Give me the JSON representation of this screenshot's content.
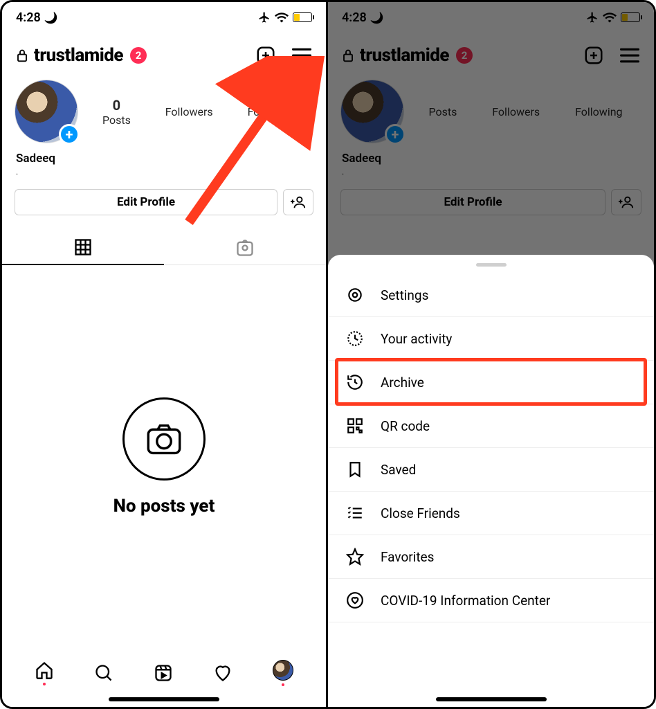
{
  "status": {
    "time": "4:28"
  },
  "colors": {
    "notif": "#ff2d55",
    "battery_fill": "#ffcc00",
    "highlight": "#ff3b1f",
    "plus_blue": "#0098fe"
  },
  "profile": {
    "username": "trustlamide",
    "notif_count": "2",
    "display_name": "Sadeeq",
    "bio": ".",
    "stats": {
      "posts_num": "0",
      "posts_label": "Posts",
      "followers_num": "",
      "followers_label": "Followers",
      "following_num": "",
      "following_label": "Following"
    },
    "edit_label": "Edit Profile"
  },
  "empty": {
    "message": "No posts yet"
  },
  "menu": {
    "items": [
      {
        "label": "Settings",
        "icon": "gear-icon"
      },
      {
        "label": "Your activity",
        "icon": "activity-icon"
      },
      {
        "label": "Archive",
        "icon": "archive-icon"
      },
      {
        "label": "QR code",
        "icon": "qrcode-icon"
      },
      {
        "label": "Saved",
        "icon": "bookmark-icon"
      },
      {
        "label": "Close Friends",
        "icon": "close-friends-icon"
      },
      {
        "label": "Favorites",
        "icon": "star-icon"
      },
      {
        "label": "COVID-19 Information Center",
        "icon": "heart-info-icon"
      }
    ],
    "highlighted_index": 2
  }
}
